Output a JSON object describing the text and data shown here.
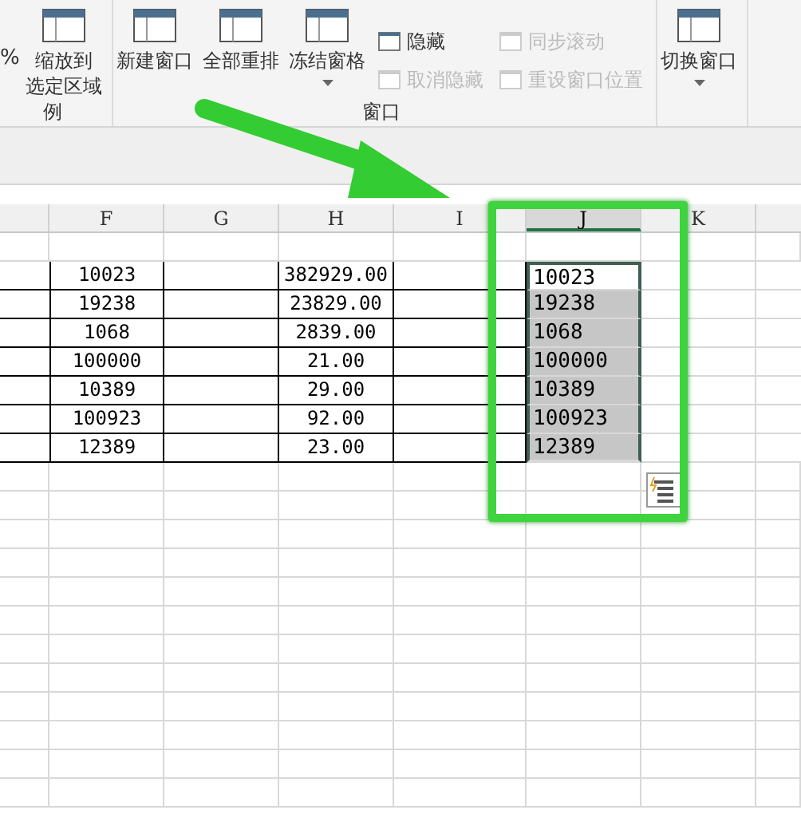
{
  "ribbon": {
    "groups": [
      {
        "label": "例",
        "items": [
          {
            "kind": "partial",
            "label": "%"
          },
          {
            "kind": "large",
            "lines": [
              "缩放到",
              "选定区域"
            ],
            "dropdown": false
          }
        ]
      },
      {
        "label": "窗口",
        "items": [
          {
            "kind": "large",
            "lines": [
              "新建窗口"
            ],
            "dropdown": false
          },
          {
            "kind": "large",
            "lines": [
              "全部重排"
            ],
            "dropdown": false
          },
          {
            "kind": "large",
            "lines": [
              "冻结窗格"
            ],
            "dropdown": true
          },
          {
            "kind": "stack",
            "buttons": [
              {
                "label": "隐藏",
                "disabled": false
              },
              {
                "label": "取消隐藏",
                "disabled": true
              }
            ]
          },
          {
            "kind": "stack",
            "buttons": [
              {
                "label": "同步滚动",
                "disabled": true
              },
              {
                "label": "重设窗口位置",
                "disabled": true
              }
            ]
          }
        ]
      },
      {
        "items": [
          {
            "kind": "large",
            "lines": [
              "切换窗口"
            ],
            "dropdown": true
          }
        ]
      }
    ]
  },
  "sheet": {
    "columns": [
      "F",
      "G",
      "H",
      "I",
      "J",
      "K"
    ],
    "rows": [
      {
        "f": "10023",
        "h": "382929.00",
        "j": "10023",
        "highlighted": false
      },
      {
        "f": "19238",
        "h": "23829.00",
        "j": "19238",
        "highlighted": true
      },
      {
        "f": "1068",
        "h": "2839.00",
        "j": "1068",
        "highlighted": true
      },
      {
        "f": "100000",
        "h": "21.00",
        "j": "100000",
        "highlighted": true
      },
      {
        "f": "10389",
        "h": "29.00",
        "j": "10389",
        "highlighted": true
      },
      {
        "f": "100923",
        "h": "92.00",
        "j": "100923",
        "highlighted": true
      },
      {
        "f": "12389",
        "h": "23.00",
        "j": "12389",
        "highlighted": true
      }
    ]
  }
}
